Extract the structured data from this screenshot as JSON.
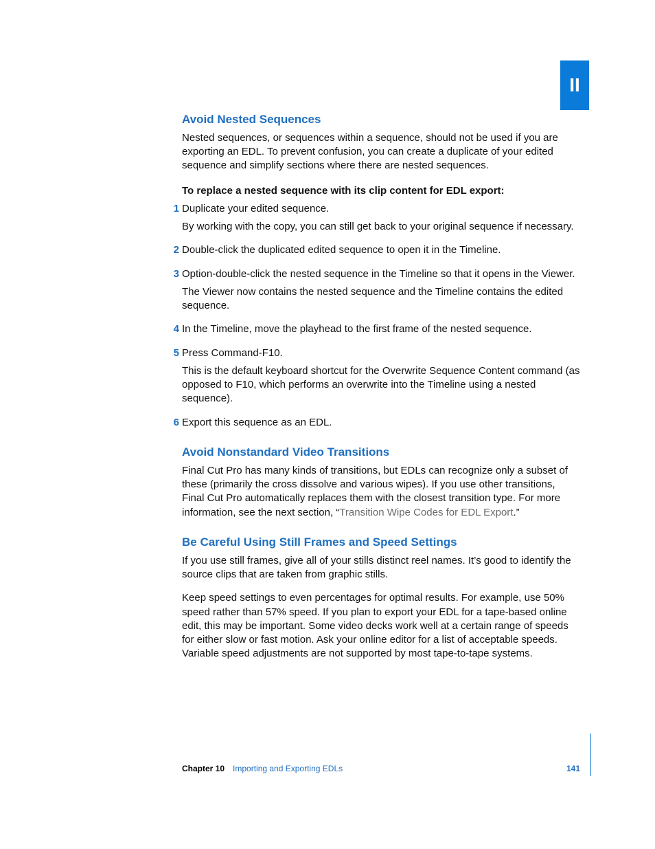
{
  "part_label": "II",
  "section1": {
    "heading": "Avoid Nested Sequences",
    "intro": "Nested sequences, or sequences within a sequence, should not be used if you are exporting an EDL. To prevent confusion, you can create a duplicate of your edited sequence and simplify sections where there are nested sequences.",
    "task_intro": "To replace a nested sequence with its clip content for EDL export:",
    "steps": [
      {
        "num": "1",
        "body": "Duplicate your edited sequence.",
        "sub": "By working with the copy, you can still get back to your original sequence if necessary."
      },
      {
        "num": "2",
        "body": "Double-click the duplicated edited sequence to open it in the Timeline."
      },
      {
        "num": "3",
        "body": "Option-double-click the nested sequence in the Timeline so that it opens in the Viewer.",
        "sub": "The Viewer now contains the nested sequence and the Timeline contains the edited sequence."
      },
      {
        "num": "4",
        "body": "In the Timeline, move the playhead to the first frame of the nested sequence."
      },
      {
        "num": "5",
        "body": "Press Command-F10.",
        "sub": "This is the default keyboard shortcut for the Overwrite Sequence Content command (as opposed to F10, which performs an overwrite into the Timeline using a nested sequence)."
      },
      {
        "num": "6",
        "body": "Export this sequence as an EDL."
      }
    ]
  },
  "section2": {
    "heading": "Avoid Nonstandard Video Transitions",
    "body_pre": "Final Cut Pro has many kinds of transitions, but EDLs can recognize only a subset of these (primarily the cross dissolve and various wipes). If you use other transitions, Final Cut Pro automatically replaces them with the closest transition type. For more information, see the next section, “",
    "link": "Transition Wipe Codes for EDL Export",
    "body_post": ".”"
  },
  "section3": {
    "heading": "Be Careful Using Still Frames and Speed Settings",
    "p1": "If you use still frames, give all of your stills distinct reel names. It’s good to identify the source clips that are taken from graphic stills.",
    "p2": "Keep speed settings to even percentages for optimal results. For example, use 50% speed rather than 57% speed. If you plan to export your EDL for a tape-based online edit, this may be important. Some video decks work well at a certain range of speeds for either slow or fast motion. Ask your online editor for a list of acceptable speeds. Variable speed adjustments are not supported by most tape-to-tape systems."
  },
  "footer": {
    "chapter_label": "Chapter 10",
    "chapter_title": "Importing and Exporting EDLs",
    "page": "141"
  }
}
